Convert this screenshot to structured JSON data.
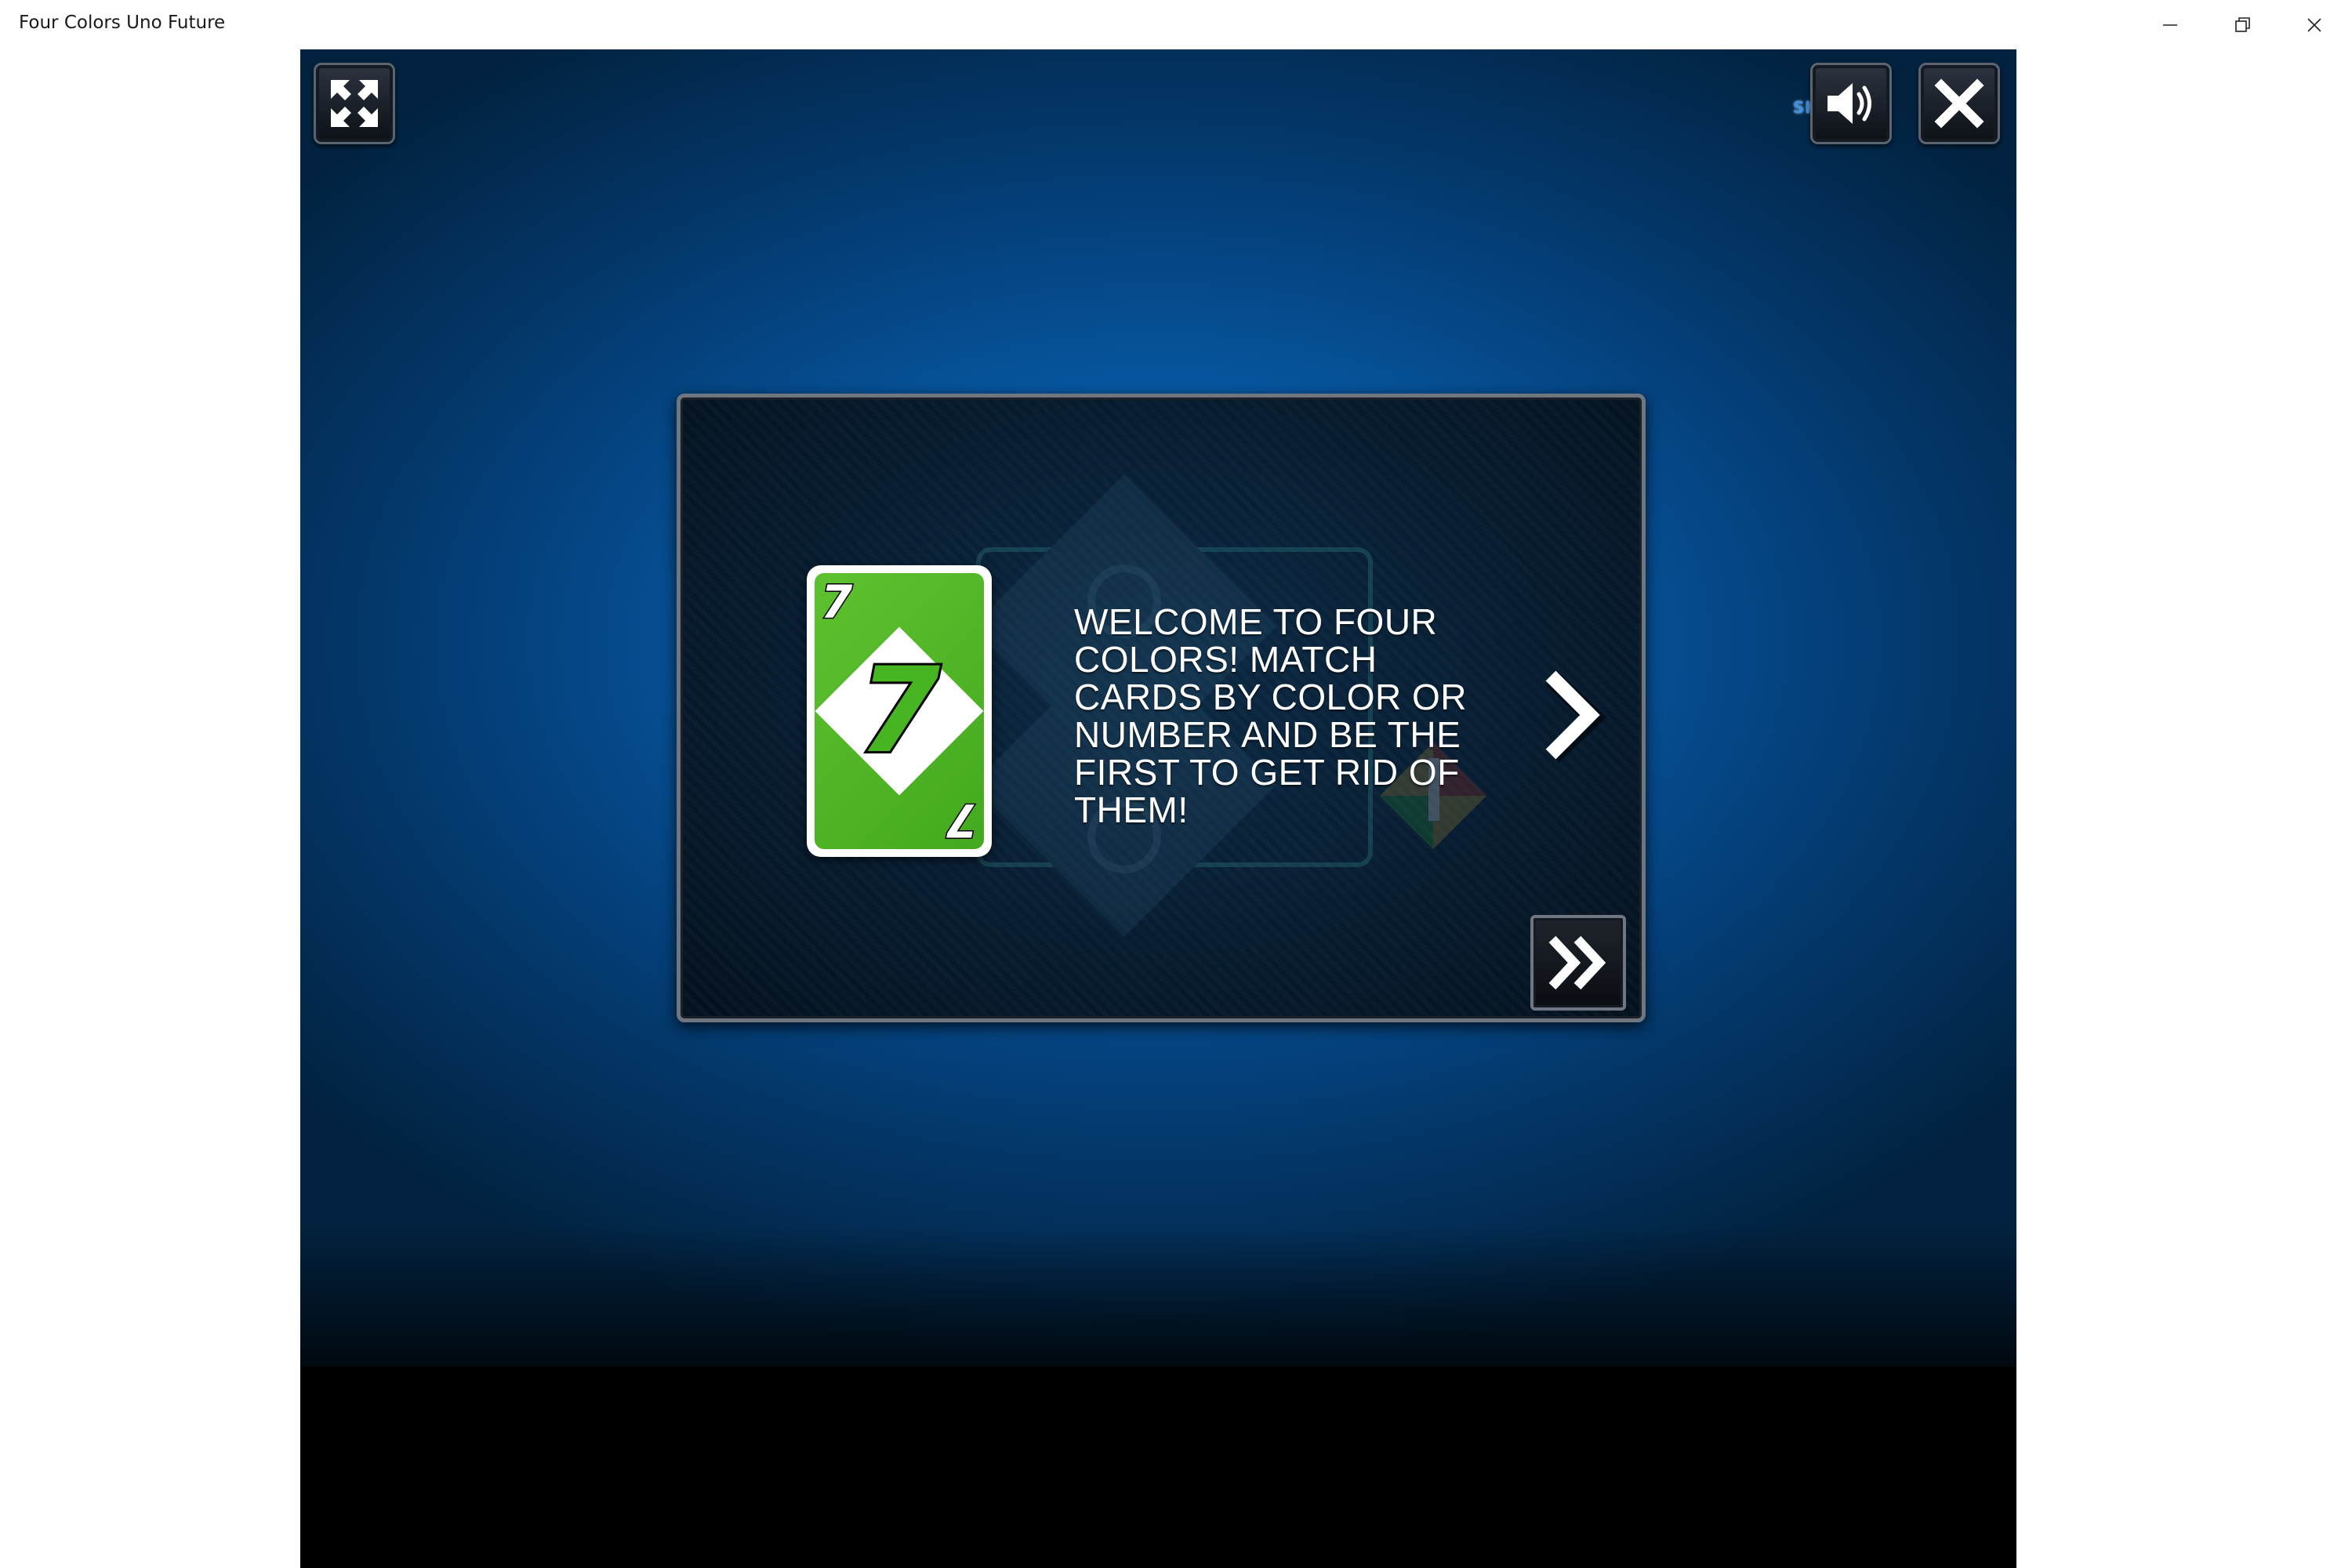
{
  "window": {
    "title": "Four Colors Uno Future"
  },
  "titlebar": {
    "minimize_icon": "minimize-icon",
    "maximize_icon": "restore-icon",
    "close_icon": "close-icon"
  },
  "toolbar": {
    "fullscreen_icon": "fullscreen-icon",
    "sound_icon": "speaker-icon",
    "close_icon": "close-icon",
    "logo_text": "SHTOBA"
  },
  "tutorial": {
    "message": "WELCOME TO FOUR COLORS! MATCH CARDS BY COLOR OR NUMBER AND BE THE FIRST TO GET RID OF THEM!",
    "next_icon": "chevron-right-icon",
    "skip_icon": "double-chevron-right-icon"
  },
  "card": {
    "color": "#4cb526",
    "value": "7",
    "corner_value": "7"
  },
  "colors": {
    "stage_accent": "#0a6fc4",
    "card_green": "#4cb526"
  }
}
